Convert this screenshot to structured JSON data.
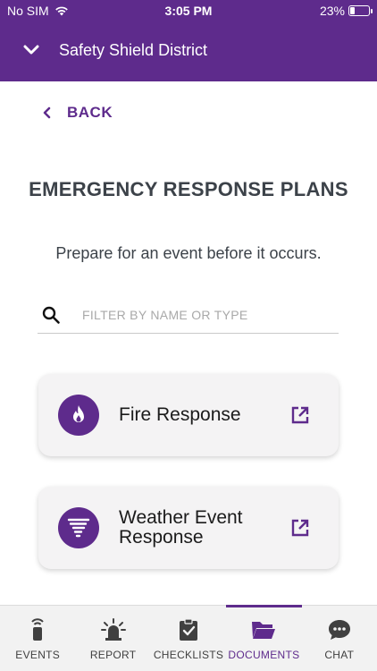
{
  "status_bar": {
    "carrier": "No SIM",
    "time": "3:05 PM",
    "battery": "23%"
  },
  "header": {
    "title": "Safety Shield District"
  },
  "back": {
    "label": "BACK"
  },
  "page": {
    "title": "EMERGENCY RESPONSE PLANS",
    "subtitle": "Prepare for an event before it occurs."
  },
  "search": {
    "placeholder": "FILTER BY NAME OR TYPE",
    "value": ""
  },
  "documents": [
    {
      "label": "Fire Response",
      "icon": "fire-icon"
    },
    {
      "label": "Weather Event Response",
      "icon": "tornado-icon"
    }
  ],
  "nav": {
    "active": "DOCUMENTS",
    "items": [
      {
        "label": "EVENTS",
        "icon": "signal-beacon-icon"
      },
      {
        "label": "REPORT",
        "icon": "alarm-light-icon"
      },
      {
        "label": "CHECKLISTS",
        "icon": "clipboard-check-icon"
      },
      {
        "label": "DOCUMENTS",
        "icon": "folder-open-icon"
      },
      {
        "label": "CHAT",
        "icon": "chat-bubble-icon"
      }
    ]
  },
  "colors": {
    "brand": "#5e2b8c",
    "text": "#3c4249",
    "card": "#f4f3f4"
  }
}
